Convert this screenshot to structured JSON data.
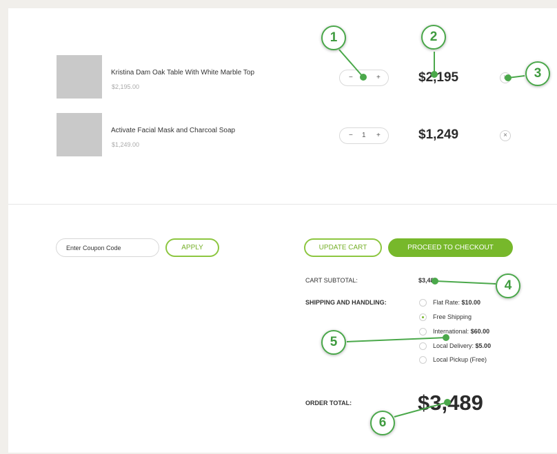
{
  "cart": {
    "items": [
      {
        "name": "Kristina Dam Oak Table With White Marble Top",
        "unit_price": "$2,195.00",
        "quantity": "1",
        "total": "$2,195"
      },
      {
        "name": "Activate Facial Mask and Charcoal Soap",
        "unit_price": "$1,249.00",
        "quantity": "1",
        "total": "$1,249"
      }
    ],
    "stepper": {
      "minus": "−",
      "plus": "+"
    },
    "remove_glyph": "×"
  },
  "coupon": {
    "placeholder": "Enter Coupon Code",
    "apply_label": "APPLY"
  },
  "actions": {
    "update_label": "UPDATE CART",
    "checkout_label": "PROCEED TO CHECKOUT"
  },
  "summary": {
    "subtotal_label": "CART SUBTOTAL:",
    "subtotal_value": "$3,489",
    "shipping_label": "SHIPPING AND HANDLING:",
    "shipping_options": [
      {
        "label": "Flat Rate:",
        "price": "$10.00",
        "selected": false
      },
      {
        "label": "Free Shipping",
        "price": "",
        "selected": true
      },
      {
        "label": "International:",
        "price": "$60.00",
        "selected": false
      },
      {
        "label": "Local Delivery:",
        "price": "$5.00",
        "selected": false
      },
      {
        "label": "Local Pickup (Free)",
        "price": "",
        "selected": false
      }
    ],
    "order_total_label": "ORDER TOTAL:",
    "order_total_value": "$3,489"
  },
  "annotations": [
    "1",
    "2",
    "3",
    "4",
    "5",
    "6"
  ],
  "colors": {
    "accent": "#77b82b",
    "annotation": "#4aa84a",
    "background": "#f1efeb"
  }
}
